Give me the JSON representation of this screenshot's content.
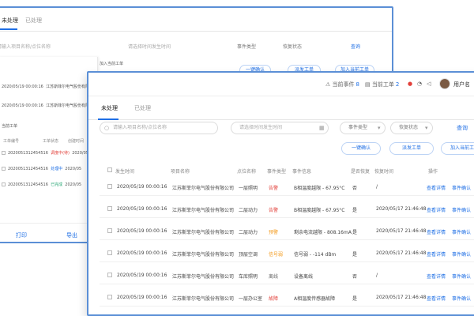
{
  "back": {
    "tabs": [
      "未处理",
      "已处理"
    ],
    "search_placeholder": "请输入项目名称/点位名称",
    "time_placeholder": "请选择时间发生时间",
    "select1": "事件类型",
    "select2": "恢复状态",
    "query": "查询",
    "buttons": [
      "一键确认",
      "派发工单",
      "加入当前工单"
    ],
    "panel_title": "加入当前工单",
    "panel_rows": [
      {
        "time": "2020/05/19 00:00:16",
        "name": "江苏斯菲尔电气股份有限"
      },
      {
        "time": "2020/05/19 00:00:16",
        "name": "江苏斯菲尔电气股份有限"
      }
    ],
    "panel_head": [
      "工单编号",
      "工单状态",
      "创建时间"
    ],
    "panel_section": "当前工单",
    "tickets": [
      {
        "id": "2020051312454516",
        "status": "调度中(待)",
        "date": "2020/05"
      },
      {
        "id": "2020051312454516",
        "status": "处理中",
        "date": "2020/05"
      },
      {
        "id": "2020051312454516",
        "status": "已完成",
        "date": "2020/05"
      }
    ],
    "print": "打印",
    "export": "导出"
  },
  "front": {
    "topbar": {
      "current_events": "当前事件",
      "current_events_count": "8",
      "current_tickets": "当前工单",
      "current_tickets_count": "2",
      "username": "用户名"
    },
    "tabs": [
      "未处理",
      "已处理"
    ],
    "search_placeholder": "请输入项目名称/点位名称",
    "time_placeholder": "请选择时间发生时间",
    "select1": "事件类型",
    "select2": "恢复状态",
    "query": "查询",
    "buttons": [
      "一键确认",
      "派发工单",
      "加入当前工单"
    ],
    "columns": [
      "发生时间",
      "项目名称",
      "点位名称",
      "事件类型",
      "事件信息",
      "是否恢复",
      "恢复时间",
      "操作"
    ],
    "rows": [
      {
        "time": "2020/05/19  00:00:16",
        "project": "江苏斯菲尔电气股份有限公司",
        "point": "一层照明",
        "type": "告警",
        "type_color": "red",
        "info": "B相温度越限 - 67.95°C",
        "recovered": "否",
        "recover_time": "/",
        "op1": "查看详情",
        "op2": "事件确认"
      },
      {
        "time": "2020/05/19  00:00:16",
        "project": "江苏斯菲尔电气股份有限公司",
        "point": "二层动力",
        "type": "告警",
        "type_color": "red",
        "info": "B相温度越限 - 67.95°C",
        "recovered": "是",
        "recover_time": "2020/05/17  21:46:48",
        "op1": "查看详情",
        "op2": "事件确认"
      },
      {
        "time": "2020/05/19  00:00:16",
        "project": "江苏斯菲尔电气股份有限公司",
        "point": "二层动力",
        "type": "预警",
        "type_color": "orange",
        "info": "剩余电流越限 - 808.16mA",
        "recovered": "是",
        "recover_time": "2020/05/17  21:46:48",
        "op1": "查看详情",
        "op2": "事件确认"
      },
      {
        "time": "2020/05/19  00:00:16",
        "project": "江苏斯菲尔电气股份有限公司",
        "point": "顶层空调",
        "type": "信号弱",
        "type_color": "orange",
        "info": "信号弱 - -114 dBm",
        "recovered": "是",
        "recover_time": "2020/05/17  21:46:48",
        "op1": "查看详情",
        "op2": "事件确认"
      },
      {
        "time": "2020/05/19  00:00:16",
        "project": "江苏斯菲尔电气股份有限公司",
        "point": "车库照明",
        "type": "离线",
        "type_color": "gray",
        "info": "设备离线",
        "recovered": "否",
        "recover_time": "/",
        "op1": "查看详情",
        "op2": "事件确认"
      },
      {
        "time": "2020/05/19  00:00:16",
        "project": "江苏斯菲尔电气股份有限公司",
        "point": "一层办公室",
        "type": "故障",
        "type_color": "red",
        "info": "A相温度传感器故障",
        "recovered": "是",
        "recover_time": "2020/05/17  21:46:48",
        "op1": "查看详情",
        "op2": "事件确认"
      }
    ]
  },
  "colors": {
    "accent": "#1f6fe5",
    "alarm": "#e2403a",
    "warning": "#f39a1c",
    "frame": "#5b8fd6"
  }
}
